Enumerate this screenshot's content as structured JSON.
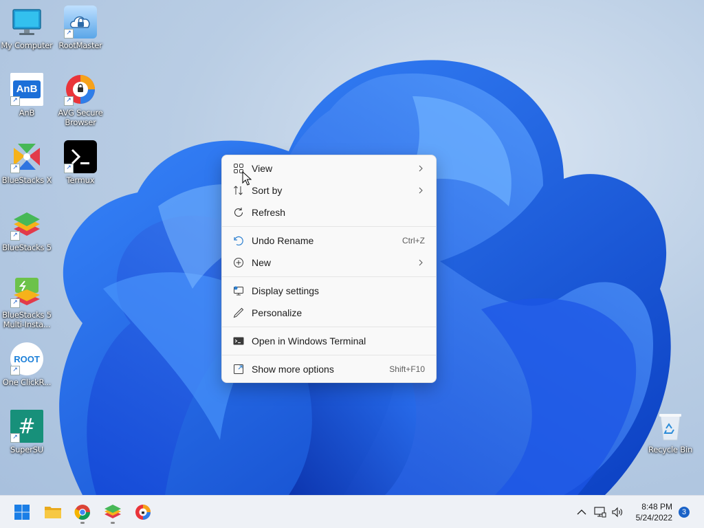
{
  "desktop": {
    "icons": [
      {
        "label": "My Computer"
      },
      {
        "label": "RootMaster"
      },
      {
        "label": "AnB",
        "tile_text": "AnB"
      },
      {
        "label": "AVG Secure Browser"
      },
      {
        "label": "BlueStacks X"
      },
      {
        "label": "Termux"
      },
      {
        "label": "BlueStacks 5"
      },
      {
        "label": "BlueStacks 5 Multi-Insta..."
      },
      {
        "label": "One ClickR...",
        "tile_text": "ROOT"
      },
      {
        "label": "SuperSU",
        "tile_text": "#"
      },
      {
        "label": "Recycle Bin"
      }
    ]
  },
  "context_menu": {
    "items": [
      {
        "label": "View",
        "icon": "grid-icon",
        "submenu": true
      },
      {
        "label": "Sort by",
        "icon": "sort-icon",
        "submenu": true
      },
      {
        "label": "Refresh",
        "icon": "refresh-icon"
      },
      {
        "label": "Undo Rename",
        "icon": "undo-icon",
        "shortcut": "Ctrl+Z"
      },
      {
        "label": "New",
        "icon": "plus-circle-icon",
        "submenu": true
      },
      {
        "label": "Display settings",
        "icon": "display-icon"
      },
      {
        "label": "Personalize",
        "icon": "pen-icon"
      },
      {
        "label": "Open in Windows Terminal",
        "icon": "terminal-icon"
      },
      {
        "label": "Show more options",
        "icon": "expand-icon",
        "shortcut": "Shift+F10"
      }
    ]
  },
  "taskbar": {
    "apps": [
      "start-icon",
      "file-explorer-icon",
      "chrome-icon",
      "bluestacks-icon",
      "avg-browser-icon"
    ],
    "clock": {
      "time": "8:48 PM",
      "date": "5/24/2022"
    },
    "notification_count": "3"
  },
  "colors": {
    "accent": "#1a62c7",
    "wallpaper_blue": "#1f5fe0",
    "menu_bg": "#f9f9f9"
  }
}
